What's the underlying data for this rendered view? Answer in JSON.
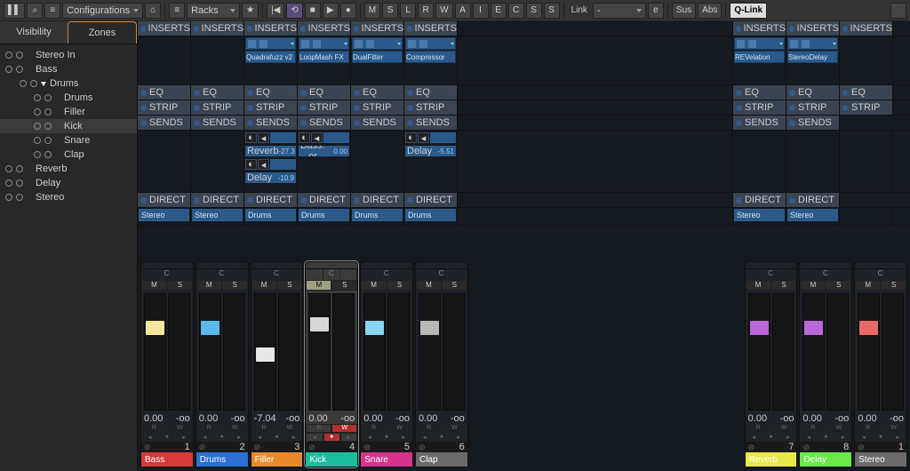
{
  "toolbar": {
    "configurations": "Configurations",
    "racks": "Racks",
    "letters": [
      "M",
      "S",
      "L",
      "R",
      "W",
      "A",
      "I",
      "E",
      "C",
      "S",
      "S"
    ],
    "link": "Link",
    "linkval": "-",
    "sus": "Sus",
    "abs": "Abs",
    "qlink": "Q-Link"
  },
  "tabs": {
    "visibility": "Visibility",
    "zones": "Zones"
  },
  "tree": [
    {
      "label": "Stereo In",
      "i": 0
    },
    {
      "label": "Bass",
      "i": 0
    },
    {
      "label": "Drums",
      "i": 1,
      "exp": true
    },
    {
      "label": "Drums",
      "i": 2
    },
    {
      "label": "Filler",
      "i": 2
    },
    {
      "label": "Kick",
      "i": 2,
      "sel": true
    },
    {
      "label": "Snare",
      "i": 2
    },
    {
      "label": "Clap",
      "i": 2
    },
    {
      "label": "Reverb",
      "i": 0
    },
    {
      "label": "Delay",
      "i": 0
    },
    {
      "label": "Stereo",
      "i": 0
    }
  ],
  "sections": {
    "inserts": "INSERTS",
    "eq": "EQ",
    "strip": "STRIP",
    "sends": "SENDS",
    "direct": "DIRECT"
  },
  "inserts": {
    "2": "Quadrafuzz v2",
    "3": "LoopMash FX",
    "4": "DualFilter",
    "5": "Compressor",
    "r1": "REVelation",
    "r2": "StereoDelay"
  },
  "sends": {
    "2a": {
      "name": "Reverb",
      "val": "-27.3"
    },
    "2b": {
      "name": "Delay",
      "val": "-10.9"
    },
    "3a": {
      "name": "Bass: ...or",
      "val": "0.00"
    },
    "5a": {
      "name": "Delay",
      "val": "-5.51"
    }
  },
  "routing": {
    "stereo": "Stereo",
    "drums": "Drums"
  },
  "channels": [
    {
      "name": "Bass",
      "color": "#d43a3a",
      "cap": "#f5e79e",
      "pos": 30,
      "val": "0.00",
      "mv": "-oo",
      "n": "1"
    },
    {
      "name": "Drums",
      "color": "#2b6fd4",
      "cap": "#5bb8e8",
      "pos": 30,
      "val": "0.00",
      "mv": "-oo",
      "n": "2"
    },
    {
      "name": "Filler",
      "color": "#e88a2b",
      "cap": "#e8e8e8",
      "pos": 60,
      "val": "-7.04",
      "mv": "-oo",
      "n": "3"
    },
    {
      "name": "Kick",
      "color": "#1abc9c",
      "cap": "#d8d8d8",
      "pos": 26,
      "val": "0.00",
      "mv": "-oo",
      "n": "4",
      "sel": true
    },
    {
      "name": "Snare",
      "color": "#d4348a",
      "cap": "#8ad4f0",
      "pos": 30,
      "val": "0.00",
      "mv": "-oo",
      "n": "5"
    },
    {
      "name": "Clap",
      "color": "#6a6a6a",
      "cap": "#b8b8b8",
      "pos": 30,
      "val": "0.00",
      "mv": "-oo",
      "n": "6"
    }
  ],
  "fxchannels": [
    {
      "name": "Reverb",
      "color": "#e8e84a",
      "cap": "#b868d8",
      "pos": 30,
      "val": "0.00",
      "mv": "-oo",
      "n": "7"
    },
    {
      "name": "Delay",
      "color": "#6ae84a",
      "cap": "#b868d8",
      "pos": 30,
      "val": "0.00",
      "mv": "-oo",
      "n": "8"
    },
    {
      "name": "Stereo",
      "color": "#6a6a6a",
      "cap": "#e86868",
      "pos": 30,
      "val": "0.00",
      "mv": "-oo",
      "n": "1"
    }
  ],
  "lbl": {
    "c": "C",
    "m": "M",
    "s": "S",
    "r": "R",
    "w": "W"
  }
}
